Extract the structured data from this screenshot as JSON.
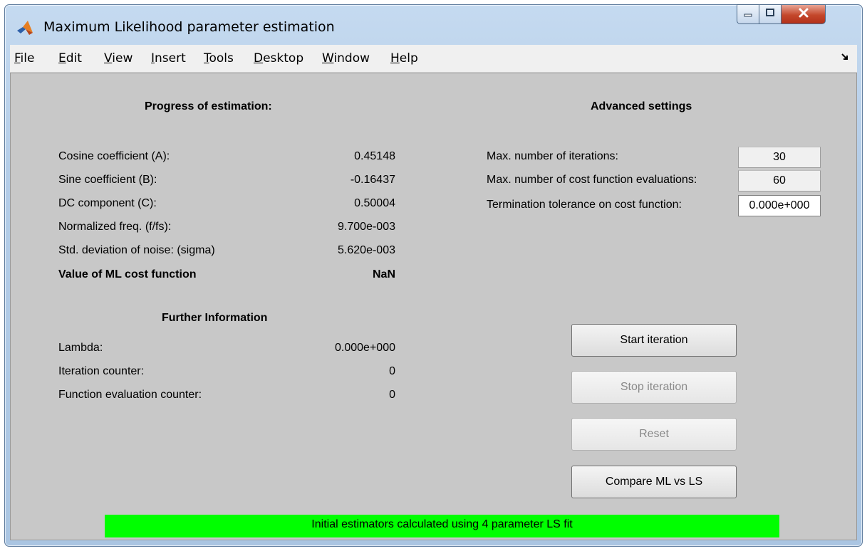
{
  "window": {
    "title": "Maximum Likelihood parameter estimation"
  },
  "menu": [
    "File",
    "Edit",
    "View",
    "Insert",
    "Tools",
    "Desktop",
    "Window",
    "Help"
  ],
  "progress": {
    "heading": "Progress of estimation:",
    "rows": [
      {
        "label": "Cosine coefficient (A):",
        "value": "0.45148"
      },
      {
        "label": "Sine coefficient (B):",
        "value": "-0.16437"
      },
      {
        "label": "DC component (C):",
        "value": "0.50004"
      },
      {
        "label": "Normalized freq. (f/fs):",
        "value": "9.700e-003"
      },
      {
        "label": "Std. deviation of noise: (sigma)",
        "value": "5.620e-003"
      }
    ],
    "cost_label": "Value of ML cost function",
    "cost_value": "NaN"
  },
  "further": {
    "heading": "Further Information",
    "rows": [
      {
        "label": "Lambda:",
        "value": "0.000e+000"
      },
      {
        "label": "Iteration counter:",
        "value": "0"
      },
      {
        "label": "Function evaluation counter:",
        "value": "0"
      }
    ]
  },
  "advanced": {
    "heading": "Advanced settings",
    "fields": [
      {
        "label": "Max. number of iterations:",
        "value": "30"
      },
      {
        "label": "Max. number of cost function evaluations:",
        "value": "60"
      },
      {
        "label": "Termination tolerance on cost function:",
        "value": "0.000e+000"
      }
    ]
  },
  "buttons": {
    "start": "Start iteration",
    "stop": "Stop iteration",
    "reset": "Reset",
    "compare": "Compare ML vs LS"
  },
  "status": "Initial estimators calculated using 4 parameter LS fit",
  "colors": {
    "status_bg": "#00ff00",
    "client_bg": "#c8c8c8",
    "close_button": "#c4472b"
  },
  "icons": {
    "app": "matlab-membrane-icon",
    "minimize": "minimize-icon",
    "maximize": "maximize-icon",
    "close": "close-icon",
    "dock": "dock-arrow-icon"
  }
}
